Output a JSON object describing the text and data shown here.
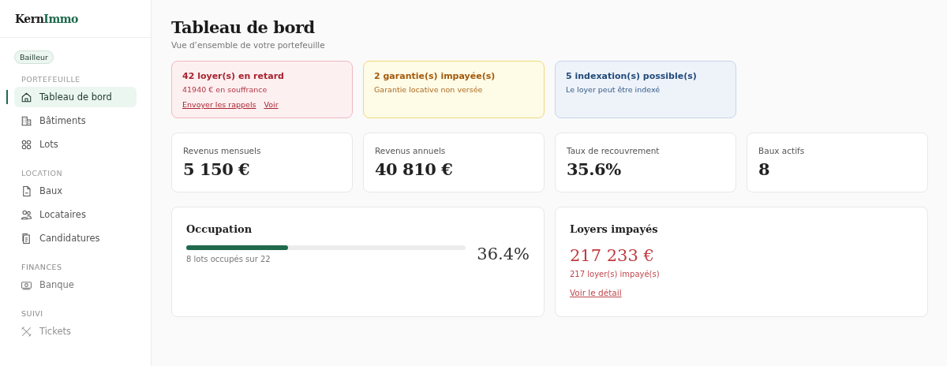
{
  "sidebar": {
    "logo": {
      "part_1": "Kern",
      "part_2": "Immo"
    },
    "role_badge": "Bailleur",
    "sections": [
      {
        "title": "PORTEFEUILLE",
        "items": [
          {
            "label": "Tableau de bord",
            "selected": true
          },
          {
            "label": "Bâtiments",
            "selected": false
          },
          {
            "label": "Lots",
            "selected": false
          }
        ]
      },
      {
        "title": "LOCATION",
        "items": [
          {
            "label": "Baux",
            "selected": false
          },
          {
            "label": "Locataires",
            "selected": false
          },
          {
            "label": "Candidatures",
            "selected": false
          }
        ]
      },
      {
        "title": "FINANCES",
        "items": [
          {
            "label": "Banque",
            "selected": false
          }
        ]
      },
      {
        "title": "SUIVI",
        "items": [
          {
            "label": "Tickets",
            "selected": false
          }
        ]
      }
    ]
  },
  "page": {
    "title": "Tableau de bord",
    "subtitle": "Vue d’ensemble de votre portefeuille"
  },
  "alerts": [
    {
      "kind": "danger",
      "title": "42 loyer(s) en retard",
      "text": "41940 € en souffrance",
      "links": [
        "Envoyer les rappels",
        "Voir"
      ]
    },
    {
      "kind": "warning",
      "title": "2 garantie(s) impayée(s)",
      "text": "Garantie locative non versée"
    },
    {
      "kind": "info",
      "title": "5 indexation(s) possible(s)",
      "text": "Le loyer peut être indexé"
    }
  ],
  "stats": [
    {
      "label": "Revenus mensuels",
      "value": "5 150 €"
    },
    {
      "label": "Revenus annuels",
      "value": "40 810 €"
    },
    {
      "label": "Taux de recouvrement",
      "value": "35.6%"
    },
    {
      "label": "Baux actifs",
      "value": "8"
    }
  ],
  "occupation": {
    "title": "Occupation",
    "level": 0.364,
    "caption": "8 lots occupés sur 22",
    "percent": "36.4%"
  },
  "unpaid": {
    "title": "Loyers impayés",
    "amount": "217 233 €",
    "count": "217 loyer(s) impayé(s)",
    "link": "Voir le détail"
  }
}
